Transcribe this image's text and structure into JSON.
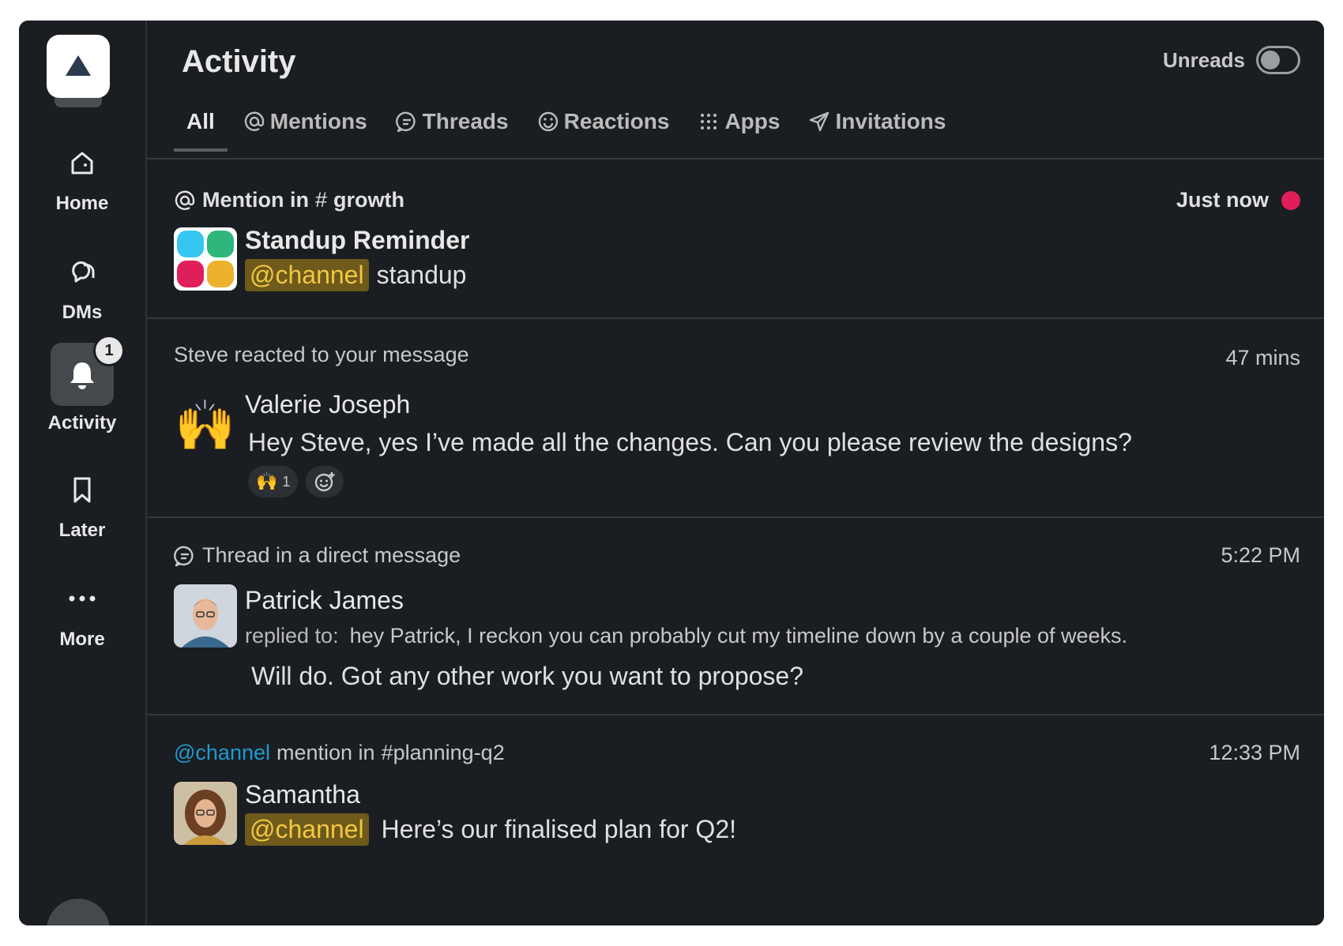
{
  "sidebar": {
    "items": [
      {
        "label": "Home",
        "icon": "home-icon"
      },
      {
        "label": "DMs",
        "icon": "dms-icon"
      },
      {
        "label": "Activity",
        "icon": "bell-icon",
        "badge": "1"
      },
      {
        "label": "Later",
        "icon": "bookmark-icon"
      },
      {
        "label": "More",
        "icon": "more-icon"
      }
    ]
  },
  "header": {
    "title": "Activity",
    "unreads_label": "Unreads"
  },
  "tabs": [
    {
      "label": "All",
      "icon": ""
    },
    {
      "label": "Mentions",
      "icon": "at-icon"
    },
    {
      "label": "Threads",
      "icon": "thread-icon"
    },
    {
      "label": "Reactions",
      "icon": "smile-icon"
    },
    {
      "label": "Apps",
      "icon": "apps-icon"
    },
    {
      "label": "Invitations",
      "icon": "paper-plane-icon"
    }
  ],
  "activity": [
    {
      "meta_prefix": "Mention in",
      "meta_channel": "growth",
      "time": "Just now",
      "sender": "Standup Reminder",
      "mention": "@channel",
      "message": "standup"
    },
    {
      "meta": "Steve reacted to your message",
      "time": "47 mins",
      "sender": "Valerie Joseph",
      "message": "Hey Steve, yes I’ve made all the changes. Can you please review the designs?",
      "reaction_count": "1"
    },
    {
      "meta": "Thread in a direct message",
      "time": "5:22 PM",
      "sender": "Patrick James",
      "replied_label": "replied to:",
      "replied_quote": "hey Patrick, I reckon you can probably cut my timeline down by a couple of weeks.",
      "message": "Will do. Got any other work you want to propose?"
    },
    {
      "meta_mention": "@channel",
      "meta_suffix": "mention in",
      "meta_channel": "#planning-q2",
      "time": "12:33 PM",
      "sender": "Samantha",
      "mention": "@channel",
      "message": "Here’s our finalised plan for Q2!"
    }
  ],
  "colors": {
    "background": "#1a1d21",
    "mention_bg": "#6e5a1a",
    "mention_fg": "#f2c744",
    "unread_dot": "#e01e5a",
    "link": "#1d9bd1"
  }
}
